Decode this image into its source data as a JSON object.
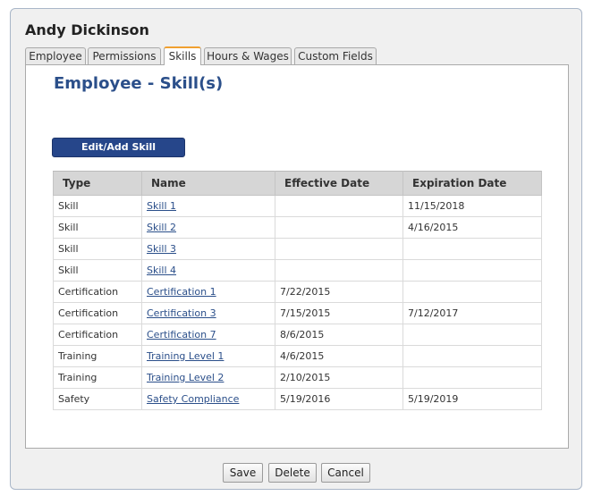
{
  "employee_name": "Andy Dickinson",
  "tabs": [
    {
      "label": "Employee"
    },
    {
      "label": "Permissions"
    },
    {
      "label": "Skills"
    },
    {
      "label": "Hours & Wages"
    },
    {
      "label": "Custom Fields"
    }
  ],
  "active_tab": "Skills",
  "page_title": "Employee - Skill(s)",
  "edit_button_label": "Edit/Add Skill",
  "table": {
    "headers": [
      "Type",
      "Name",
      "Effective Date",
      "Expiration Date"
    ],
    "rows": [
      {
        "type": "Skill",
        "name": "Skill 1",
        "effective": "",
        "expiration": "11/15/2018"
      },
      {
        "type": "Skill",
        "name": "Skill 2",
        "effective": "",
        "expiration": "4/16/2015"
      },
      {
        "type": "Skill",
        "name": "Skill 3",
        "effective": "",
        "expiration": ""
      },
      {
        "type": "Skill",
        "name": "Skill 4",
        "effective": "",
        "expiration": ""
      },
      {
        "type": "Certification",
        "name": "Certification 1",
        "effective": "7/22/2015",
        "expiration": ""
      },
      {
        "type": "Certification",
        "name": "Certification 3",
        "effective": "7/15/2015",
        "expiration": "7/12/2017"
      },
      {
        "type": "Certification",
        "name": "Certification 7",
        "effective": "8/6/2015",
        "expiration": ""
      },
      {
        "type": "Training",
        "name": "Training Level 1",
        "effective": "4/6/2015",
        "expiration": ""
      },
      {
        "type": "Training",
        "name": "Training Level 2",
        "effective": "2/10/2015",
        "expiration": ""
      },
      {
        "type": "Safety",
        "name": "Safety Compliance",
        "effective": "5/19/2016",
        "expiration": "5/19/2019"
      }
    ]
  },
  "footer": {
    "save_label": "Save",
    "delete_label": "Delete",
    "cancel_label": "Cancel"
  },
  "colors": {
    "title": "#2b4f8a",
    "button": "#26468a",
    "active_tab_accent": "#f0a030"
  }
}
